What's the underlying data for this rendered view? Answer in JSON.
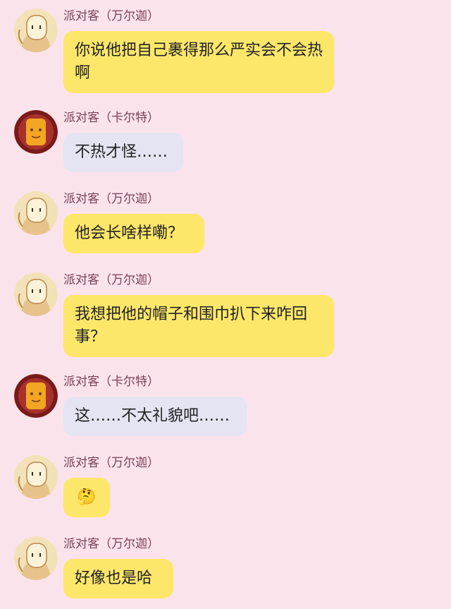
{
  "messages": [
    {
      "sender": "派对客（万尔迦）",
      "text": "你说他把自己裹得那么严实会不会热啊",
      "avatar": "vanalsa-avatar"
    },
    {
      "sender": "派对客（卡尔特）",
      "text": "不热才怪……",
      "avatar": "carter-avatar"
    },
    {
      "sender": "派对客（万尔迦）",
      "text": "他会长啥样嘞？",
      "avatar": "vanalsa-avatar"
    },
    {
      "sender": "派对客（万尔迦）",
      "text": "我想把他的帽子和围巾扒下来咋回事？",
      "avatar": "vanalsa-avatar"
    },
    {
      "sender": "派对客（卡尔特）",
      "text": "这……不太礼貌吧……",
      "avatar": "carter-avatar"
    },
    {
      "sender": "派对客（万尔迦）",
      "text": "🤔",
      "avatar": "vanalsa-avatar"
    },
    {
      "sender": "派对客（万尔迦）",
      "text": "好像也是哈",
      "avatar": "vanalsa-avatar"
    }
  ],
  "colors": {
    "background": "#fbe3ec",
    "bubble_vanalsa": "#fde76a",
    "bubble_carter": "#e5e4f2",
    "sender_name": "#7a3f56"
  }
}
